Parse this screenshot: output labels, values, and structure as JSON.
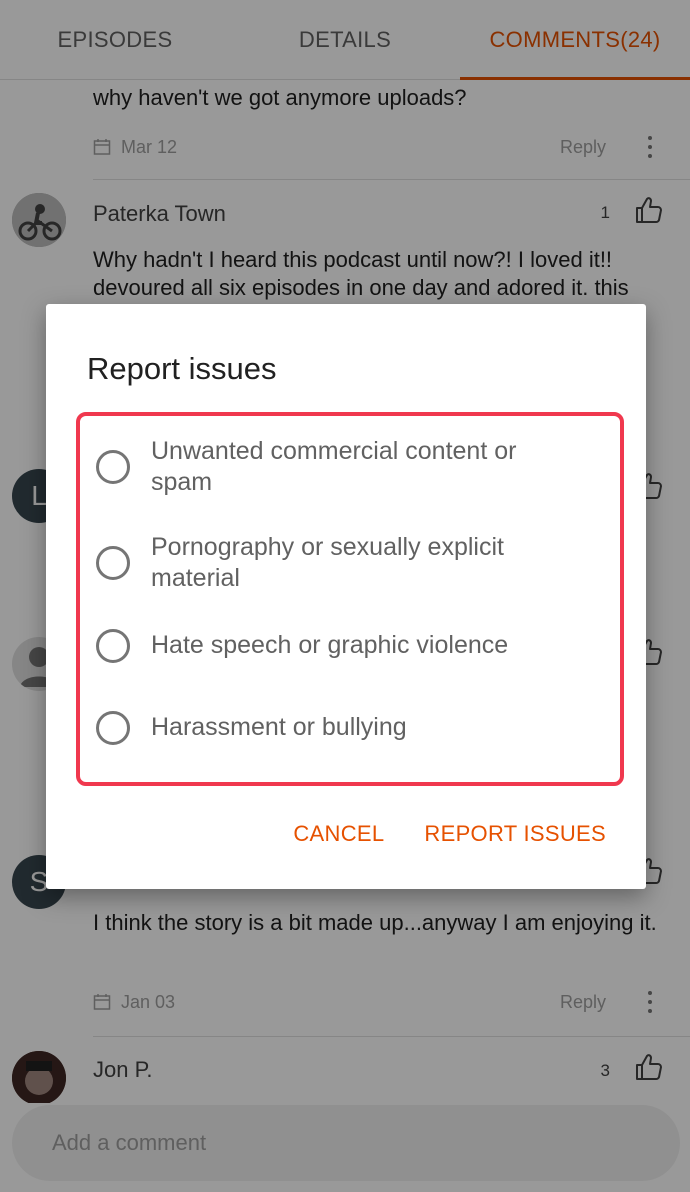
{
  "tabs": [
    {
      "label": "EPISODES"
    },
    {
      "label": "DETAILS"
    },
    {
      "label": "COMMENTS(24)"
    }
  ],
  "comments": [
    {
      "name": "",
      "text": "why haven't we got anymore uploads?",
      "date": "Mar 12",
      "reply": "Reply"
    },
    {
      "name": "Paterka Town",
      "likes": "1",
      "text": "Why hadn't I heard this podcast until now?! I loved it!! devoured all six episodes in one day and adored it. this"
    },
    {
      "avatar_letter": "L"
    },
    {
      "avatar_letter": ""
    },
    {
      "avatar_letter": "S",
      "text": "I think the story is a bit made up...anyway I am enjoying it.",
      "date": "Jan 03",
      "reply": "Reply"
    },
    {
      "name": "Jon P.",
      "likes": "3"
    }
  ],
  "composer": {
    "placeholder": "Add a comment"
  },
  "dialog": {
    "title": "Report issues",
    "options": [
      {
        "label": "Unwanted commercial content or spam"
      },
      {
        "label": "Pornography or sexually explicit material"
      },
      {
        "label": "Hate speech or graphic violence"
      },
      {
        "label": "Harassment or bullying"
      }
    ],
    "cancel_label": "CANCEL",
    "confirm_label": "REPORT ISSUES"
  },
  "colors": {
    "accent": "#e65100",
    "highlight_border": "#f0384e"
  },
  "icons": [
    "calendar-icon",
    "thumbs-up-icon",
    "more-vert-icon",
    "radio-unchecked-icon"
  ]
}
